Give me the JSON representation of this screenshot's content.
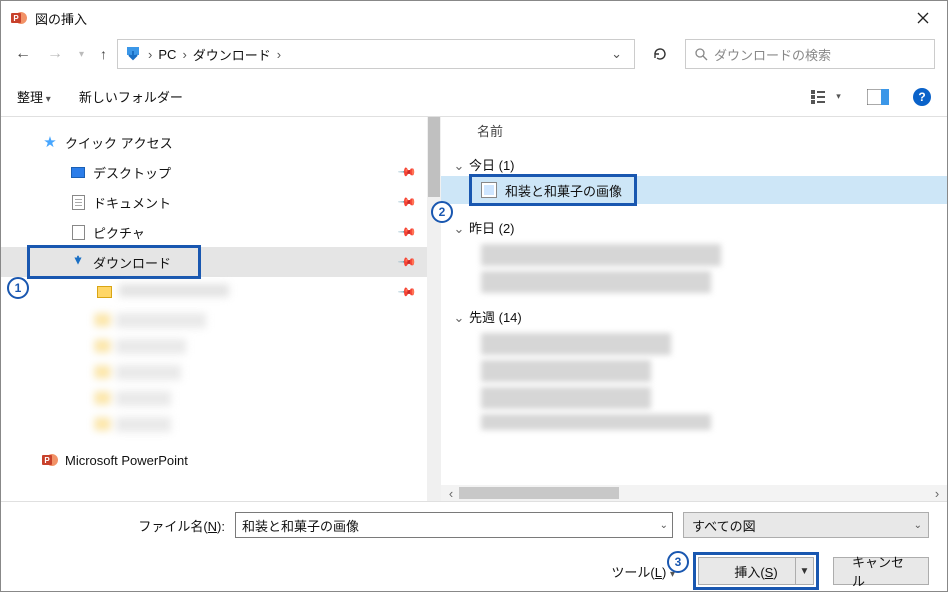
{
  "window": {
    "title": "図の挿入"
  },
  "breadcrumb": {
    "segments": [
      "PC",
      "ダウンロード"
    ]
  },
  "search": {
    "placeholder": "ダウンロードの検索"
  },
  "toolbar": {
    "organize": "整理",
    "newfolder": "新しいフォルダー"
  },
  "nav": {
    "quick_access": "クイック アクセス",
    "desktop": "デスクトップ",
    "documents": "ドキュメント",
    "pictures": "ピクチャ",
    "downloads": "ダウンロード",
    "powerpoint": "Microsoft PowerPoint"
  },
  "content": {
    "header_name": "名前",
    "group_today": "今日 (1)",
    "group_yesterday": "昨日 (2)",
    "group_lastweek": "先週 (14)",
    "selected_file": "和装と和菓子の画像"
  },
  "footer": {
    "filename_label": "ファイル名(N):",
    "filename_value": "和装と和菓子の画像",
    "filetype": "すべての図",
    "tools": "ツール(L)",
    "insert": "挿入(S)",
    "cancel": "キャンセル"
  },
  "callouts": {
    "c1": "1",
    "c2": "2",
    "c3": "3"
  }
}
